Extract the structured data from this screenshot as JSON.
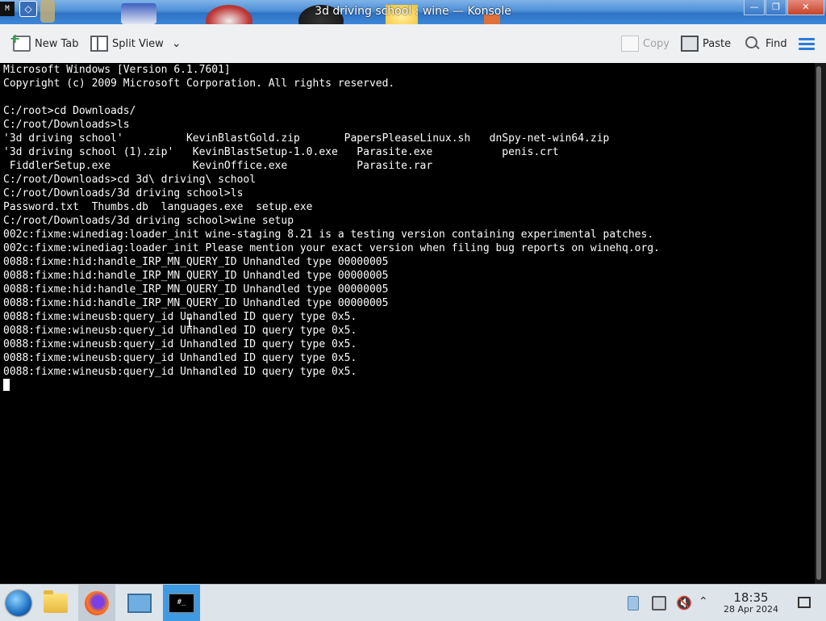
{
  "window": {
    "title": "3d driving school : wine — Konsole",
    "system_icon_text": "M",
    "diamond_icon_text": "◇",
    "min_label": "—",
    "max_label": "❐",
    "close_label": "✕"
  },
  "toolbar": {
    "new_tab_label": "New Tab",
    "split_view_label": "Split View",
    "split_view_arrow": "⌄",
    "copy_label": "Copy",
    "paste_label": "Paste",
    "find_label": "Find"
  },
  "terminal": {
    "lines": [
      "Microsoft Windows [Version 6.1.7601]",
      "Copyright (c) 2009 Microsoft Corporation. All rights reserved.",
      "",
      "C:/root>cd Downloads/",
      "C:/root/Downloads>ls",
      "'3d driving school'          KevinBlastGold.zip       PapersPleaseLinux.sh   dnSpy-net-win64.zip",
      "'3d driving school (1).zip'   KevinBlastSetup-1.0.exe   Parasite.exe           penis.crt",
      " FiddlerSetup.exe             KevinOffice.exe           Parasite.rar",
      "C:/root/Downloads>cd 3d\\ driving\\ school",
      "C:/root/Downloads/3d driving school>ls",
      "Password.txt  Thumbs.db  languages.exe  setup.exe",
      "C:/root/Downloads/3d driving school>wine setup",
      "002c:fixme:winediag:loader_init wine-staging 8.21 is a testing version containing experimental patches.",
      "002c:fixme:winediag:loader_init Please mention your exact version when filing bug reports on winehq.org.",
      "0088:fixme:hid:handle_IRP_MN_QUERY_ID Unhandled type 00000005",
      "0088:fixme:hid:handle_IRP_MN_QUERY_ID Unhandled type 00000005",
      "0088:fixme:hid:handle_IRP_MN_QUERY_ID Unhandled type 00000005",
      "0088:fixme:hid:handle_IRP_MN_QUERY_ID Unhandled type 00000005",
      "0088:fixme:wineusb:query_id Unhandled ID query type 0x5.",
      "0088:fixme:wineusb:query_id Unhandled ID query type 0x5.",
      "0088:fixme:wineusb:query_id Unhandled ID query type 0x5.",
      "0088:fixme:wineusb:query_id Unhandled ID query type 0x5.",
      "0088:fixme:wineusb:query_id Unhandled ID query type 0x5."
    ]
  },
  "taskbar": {
    "apps": [
      {
        "name": "start-menu",
        "icon": "windows-orb-icon"
      },
      {
        "name": "file-manager",
        "icon": "folder-icon"
      },
      {
        "name": "firefox",
        "icon": "firefox-icon"
      },
      {
        "name": "system-settings",
        "icon": "monitor-icon"
      },
      {
        "name": "konsole",
        "icon": "terminal-icon"
      }
    ],
    "terminal_icon_text": "#_",
    "clock_time": "18:35",
    "clock_date": "28 Apr 2024"
  },
  "colors": {
    "terminal_bg": "#000000",
    "terminal_fg": "#fcfcfc",
    "accent": "#2a7bd8",
    "taskbar_current": "#3f9ae4"
  }
}
